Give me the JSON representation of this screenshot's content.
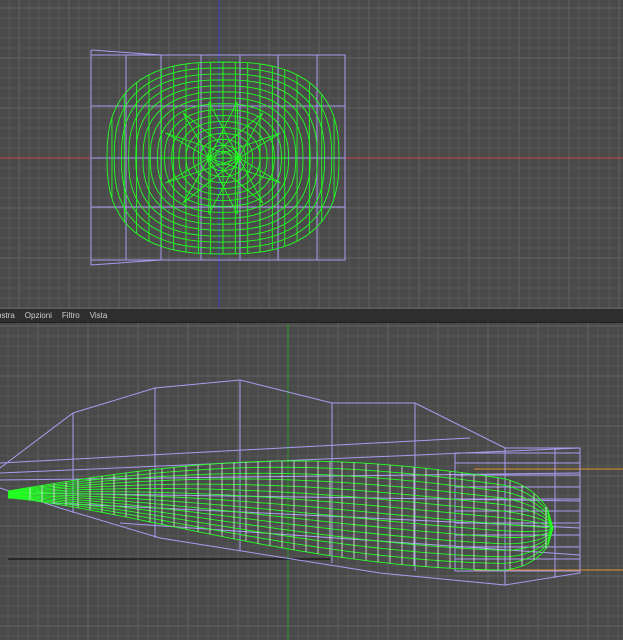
{
  "menubar": {
    "items": [
      {
        "label": "ostra"
      },
      {
        "label": "Opzioni"
      },
      {
        "label": "Filtro"
      },
      {
        "label": "Vista"
      }
    ]
  },
  "colors": {
    "background": "#4a4a4a",
    "grid_minor": "#575757",
    "grid_major": "#626262",
    "wireframe": "#22ff22",
    "cage": "#a89cf0",
    "axis_x": "#c84040",
    "axis_y": "#4040c8",
    "axis_y_bottom": "#2a9a2a",
    "guide": "#e0912a",
    "ground": "#151515"
  }
}
